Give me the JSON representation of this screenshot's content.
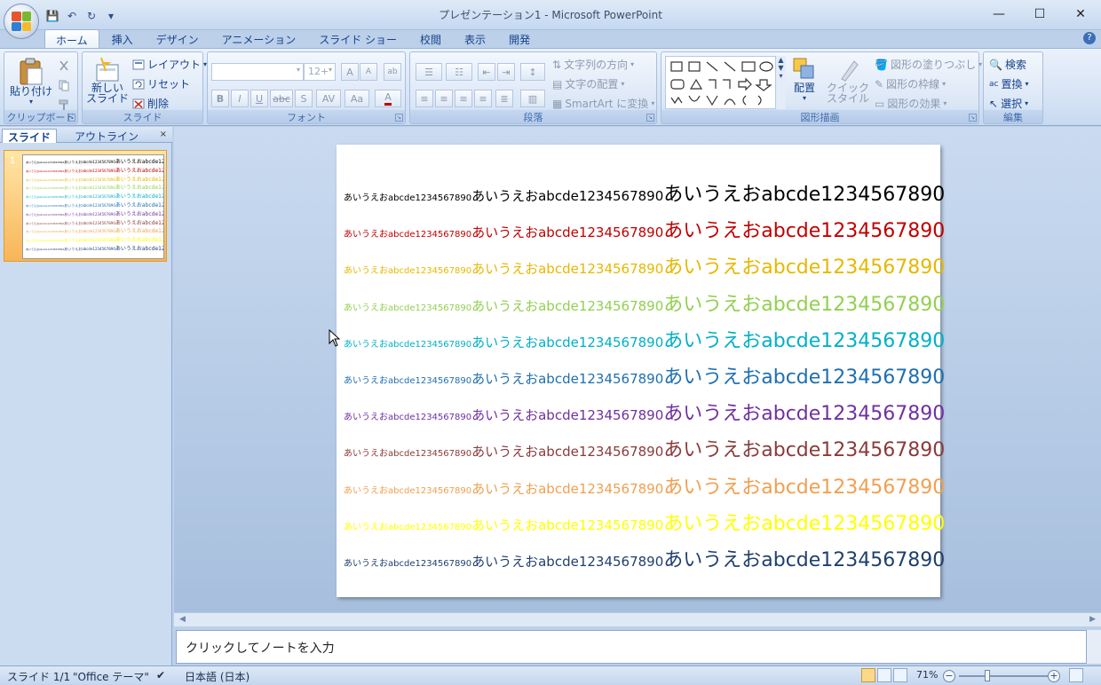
{
  "window": {
    "title": "プレゼンテーション1 - Microsoft PowerPoint",
    "minimize": "—",
    "maximize": "☐",
    "close": "✕"
  },
  "qat": {
    "save": "💾",
    "undo": "↶",
    "redo": "↻",
    "more": "▾"
  },
  "tabs": [
    "ホーム",
    "挿入",
    "デザイン",
    "アニメーション",
    "スライド ショー",
    "校閲",
    "表示",
    "開発"
  ],
  "ribbon": {
    "clipboard": {
      "label": "クリップボード",
      "paste": "貼り付け"
    },
    "slides": {
      "label": "スライド",
      "new_slide_1": "新しい",
      "new_slide_2": "スライド",
      "layout": "レイアウト",
      "reset": "リセット",
      "delete": "削除"
    },
    "font": {
      "label": "フォント",
      "size": "12+",
      "bold": "B",
      "italic": "I",
      "underline": "U",
      "strike": "abc",
      "shadow": "S",
      "spacing": "AV",
      "case": "Aa",
      "color": "A",
      "grow": "A",
      "shrink": "A"
    },
    "paragraph": {
      "label": "段落",
      "text_direction": "文字列の方向",
      "align_text": "文字の配置",
      "smartart": "SmartArt に変換"
    },
    "drawing": {
      "label": "図形描画",
      "arrange": "配置",
      "quick_styles_1": "クイック",
      "quick_styles_2": "スタイル",
      "shape_fill": "図形の塗りつぶし",
      "shape_outline": "図形の枠線",
      "shape_effects": "図形の効果"
    },
    "editing": {
      "label": "編集",
      "find": "検索",
      "replace": "置換",
      "select": "選択"
    }
  },
  "left_pane": {
    "tab_slides": "スライド",
    "tab_outline": "アウトライン",
    "close": "×",
    "slide_number": "1"
  },
  "slide": {
    "row_text_small": "あいうえおabcde1234567890",
    "row_text_medium": "あいうえおabcde1234567890",
    "row_text_large": "あいうえおabcde1234567890",
    "row_colors": [
      "#000000",
      "#c00000",
      "#e6b800",
      "#92d050",
      "#00b0c8",
      "#1f6fb0",
      "#7030a0",
      "#8b3a3a",
      "#f0a050",
      "#ffff00",
      "#1f3f6e"
    ]
  },
  "notes": {
    "placeholder": "クリックしてノートを入力"
  },
  "status": {
    "slide": "スライド 1/1",
    "theme": "\"Office テーマ\"",
    "language": "日本語 (日本)",
    "zoom": "71%"
  }
}
